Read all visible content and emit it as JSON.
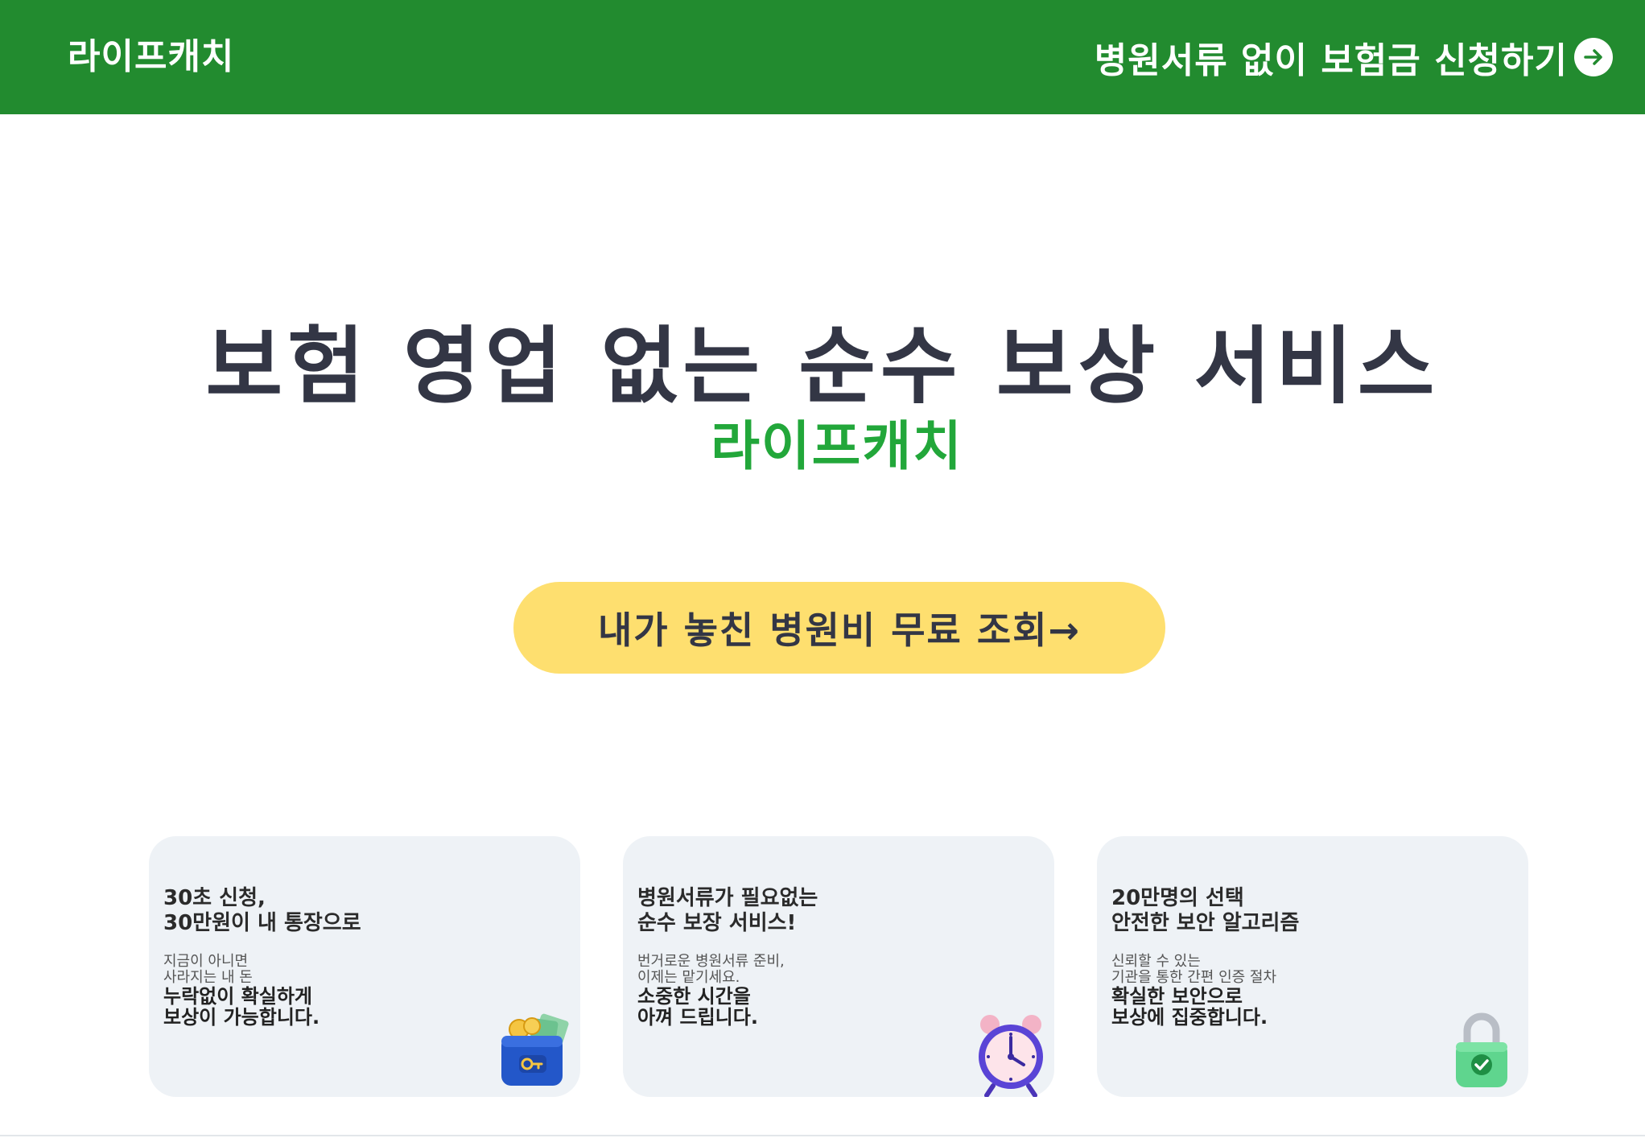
{
  "header": {
    "logo": "라이프캐치",
    "cta_label": "병원서류 없이 보험금 신청하기",
    "cta_icon": "arrow-right-circle-icon"
  },
  "hero": {
    "title": "보험 영업 없는 순수 보상 서비스",
    "brand": "라이프캐치",
    "button_label": "내가 놓친 병원비 무료 조회→"
  },
  "cards": [
    {
      "title_lines": [
        "30초 신청,",
        "30만원이 내 통장으로"
      ],
      "sub_lines": [
        "지금이 아니면",
        "사라지는 내 돈"
      ],
      "desc_lines": [
        "누락없이 확실하게",
        "보상이 가능합니다."
      ],
      "icon": "wallet-icon"
    },
    {
      "title_lines": [
        "병원서류가 필요없는",
        "순수 보장 서비스!"
      ],
      "sub_lines": [
        "번거로운 병원서류 준비,",
        "이제는 맡기세요."
      ],
      "desc_lines": [
        "소중한 시간을",
        "아껴 드립니다."
      ],
      "icon": "alarm-clock-icon"
    },
    {
      "title_lines": [
        "20만명의 선택",
        "안전한 보안 알고리즘"
      ],
      "sub_lines": [
        "신뢰할 수 있는",
        "기관을 통한 간편 인증 절차"
      ],
      "desc_lines": [
        "확실한 보안으로",
        "보상에 집중합니다."
      ],
      "icon": "padlock-icon"
    }
  ],
  "colors": {
    "header_bg": "#228b2f",
    "brand_green": "#22a73a",
    "cta_yellow": "#fedf6f",
    "card_bg": "#eef2f6",
    "title_dark": "#333645"
  }
}
